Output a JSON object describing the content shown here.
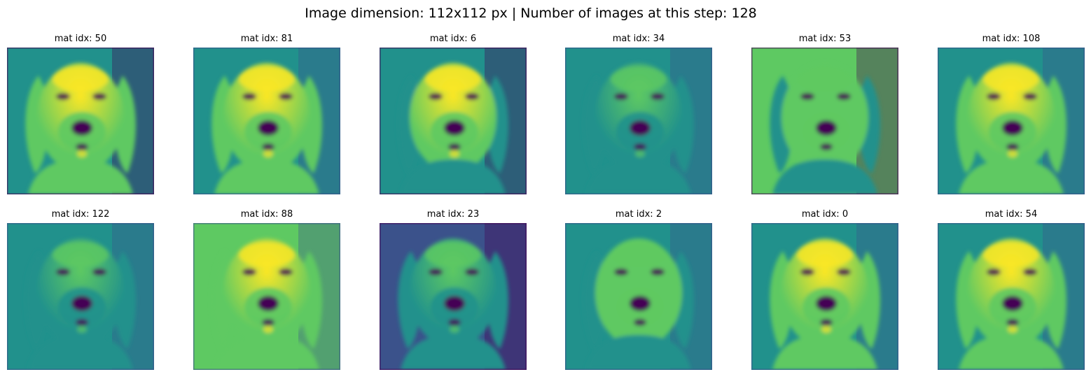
{
  "figure": {
    "title": "Image dimension: 112x112 px | Number of images at this step: 128"
  },
  "panels": [
    {
      "label": "mat idx: 50"
    },
    {
      "label": "mat idx: 81"
    },
    {
      "label": "mat idx: 6"
    },
    {
      "label": "mat idx: 34"
    },
    {
      "label": "mat idx: 53"
    },
    {
      "label": "mat idx: 108"
    },
    {
      "label": "mat idx: 122"
    },
    {
      "label": "mat idx: 88"
    },
    {
      "label": "mat idx: 23"
    },
    {
      "label": "mat idx: 2"
    },
    {
      "label": "mat idx: 0"
    },
    {
      "label": "mat idx: 54"
    }
  ],
  "colors": {
    "colormap": [
      "#440154",
      "#3b528b",
      "#21918c",
      "#5ec962",
      "#fde725"
    ]
  }
}
